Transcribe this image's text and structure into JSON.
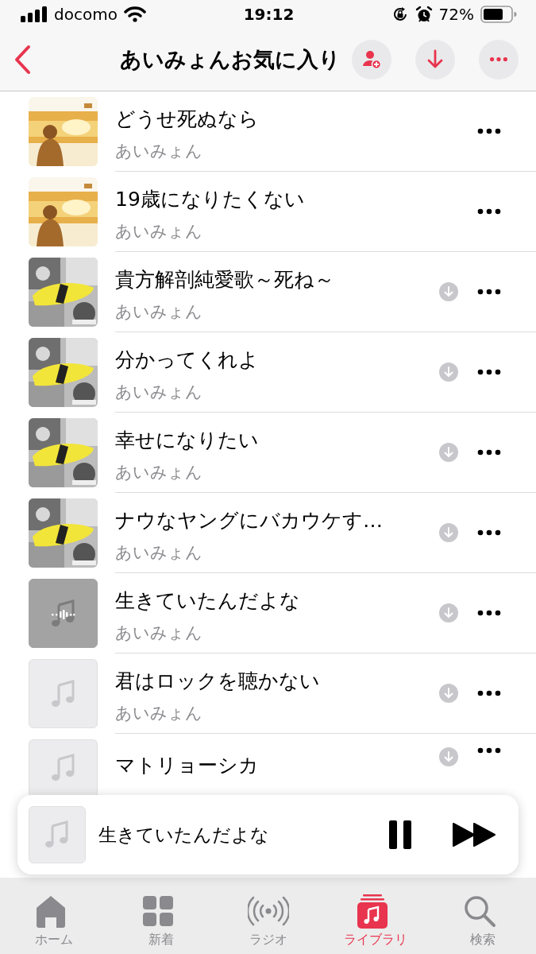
{
  "status_bar": {
    "carrier": "docomo",
    "time": "19:12",
    "battery": "72%"
  },
  "header": {
    "title": "あいみょんお気に入り"
  },
  "songs": [
    {
      "title": "どうせ死ぬなら",
      "artist": "あいみょん",
      "kind": "picture",
      "download_available": false,
      "playing": false
    },
    {
      "title": "19歳になりたくない",
      "artist": "あいみょん",
      "kind": "picture",
      "download_available": false,
      "playing": false
    },
    {
      "title": "貴方解剖純愛歌～死ね～",
      "artist": "あいみょん",
      "kind": "picture",
      "download_available": true,
      "playing": false
    },
    {
      "title": "分かってくれよ",
      "artist": "あいみょん",
      "kind": "picture",
      "download_available": true,
      "playing": false
    },
    {
      "title": "幸せになりたい",
      "artist": "あいみょん",
      "kind": "picture",
      "download_available": true,
      "playing": false
    },
    {
      "title": "ナウなヤングにバカウケす…",
      "artist": "あいみょん",
      "kind": "picture",
      "download_available": true,
      "playing": false
    },
    {
      "title": "生きていたんだよな",
      "artist": "あいみょん",
      "kind": "placeholder",
      "download_available": true,
      "playing": true
    },
    {
      "title": "君はロックを聴かない",
      "artist": "あいみょん",
      "kind": "placeholder",
      "download_available": true,
      "playing": false
    },
    {
      "title": "マトリョーシカ",
      "kind": "placeholder",
      "download_available": true,
      "playing": false
    }
  ],
  "mini_player": {
    "title": "生きていたんだよな",
    "paused": false
  },
  "tabs": [
    {
      "label": "ホーム",
      "selected": false
    },
    {
      "label": "新着",
      "selected": false
    },
    {
      "label": "ラジオ",
      "selected": false
    },
    {
      "label": "ライブラリ",
      "selected": true
    },
    {
      "label": "検索",
      "selected": false
    }
  ]
}
